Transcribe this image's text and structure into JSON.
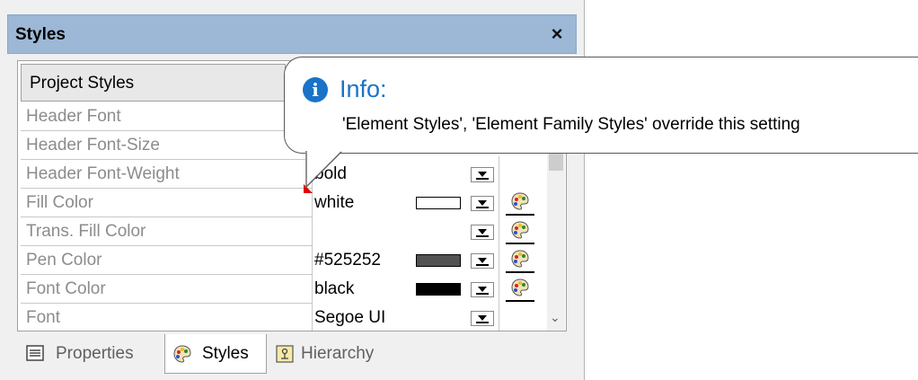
{
  "window": {
    "title": "Styles",
    "close_symbol": "×"
  },
  "section": {
    "header": "Project Styles"
  },
  "rows": [
    {
      "name": "Header Font",
      "value": ""
    },
    {
      "name": "Header Font-Size",
      "value": ""
    },
    {
      "name": "Header Font-Weight",
      "value": "bold"
    },
    {
      "name": "Fill Color",
      "value": "white",
      "swatch": "#ffffff"
    },
    {
      "name": "Trans. Fill Color",
      "value": ""
    },
    {
      "name": "Pen Color",
      "value": "#525252",
      "swatch": "#525252"
    },
    {
      "name": "Font Color",
      "value": "black",
      "swatch": "#000000"
    },
    {
      "name": "Font",
      "value": "Segoe UI"
    }
  ],
  "tabs": [
    {
      "label": "Properties",
      "icon": "properties-icon",
      "active": false
    },
    {
      "label": "Styles",
      "icon": "palette-icon",
      "active": true
    },
    {
      "label": "Hierarchy",
      "icon": "hierarchy-icon",
      "active": false
    }
  ],
  "tooltip": {
    "title": "Info:",
    "message": "'Element Styles', 'Element Family Styles' override this setting",
    "icon": "info-icon"
  },
  "colors": {
    "titlebar": "#9cb8d6",
    "info_blue": "#1a73c8",
    "warning_marker": "#e00000"
  }
}
